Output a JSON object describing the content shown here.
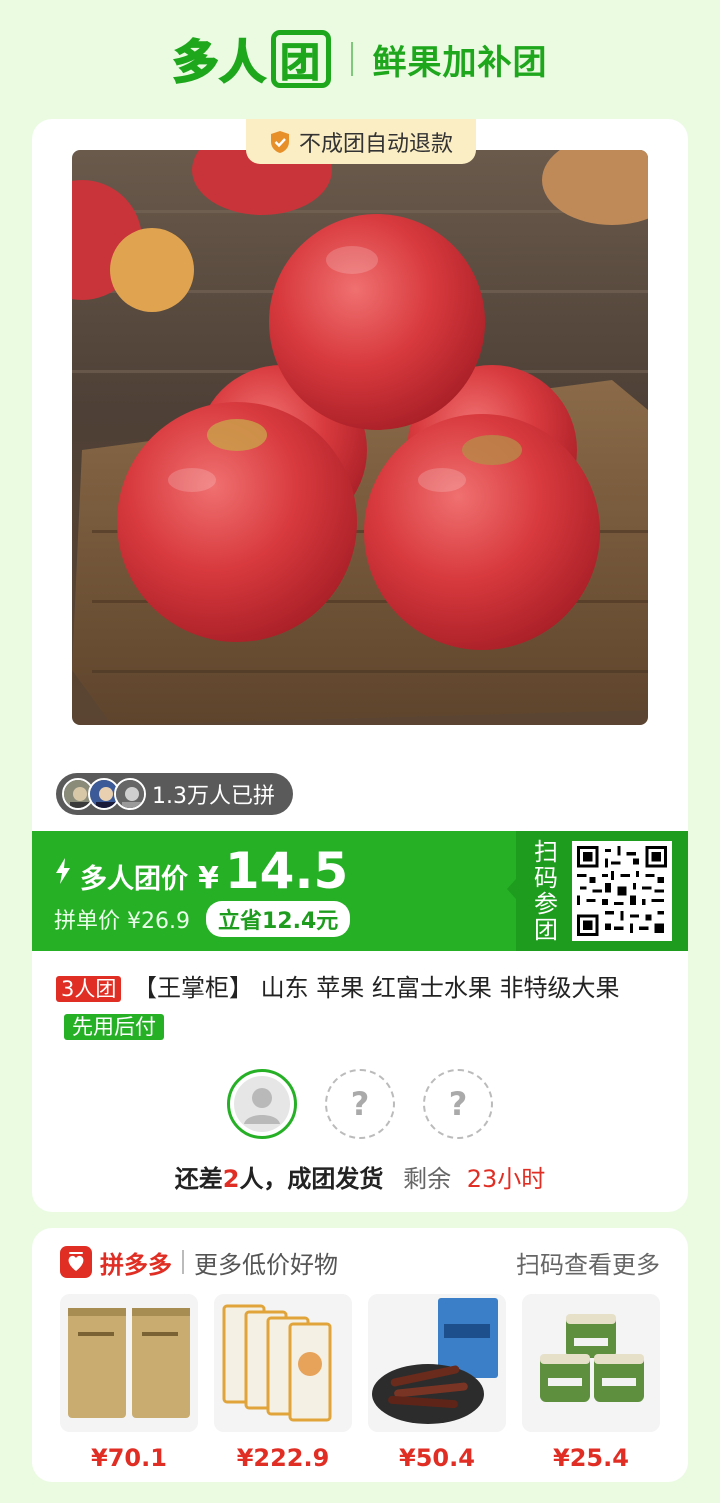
{
  "header": {
    "logo_part1": "多人",
    "logo_part2": "团",
    "subtitle": "鲜果加补团"
  },
  "product": {
    "badge": "不成团自动退款",
    "image_icon": "apples-photo",
    "joined_text": "1.3万人已拼"
  },
  "price": {
    "label": "多人团价",
    "currency": "¥",
    "group_price": "14.5",
    "original": "拼单价 ¥26.9",
    "saving": "立省12.4元",
    "scan_label": "扫码参团"
  },
  "title": {
    "group_tag": "3人团",
    "text": "【王掌柜】 山东 苹果 红富士水果 非特级大果",
    "pay_tag": "先用后付"
  },
  "group_status": {
    "prefix": "还差",
    "missing": "2",
    "suffix": "人，成团发货",
    "remain_label": "剩余",
    "remain_time": "23小时",
    "placeholder": "?"
  },
  "more": {
    "brand": "拼多多",
    "slogan": "更多低价好物",
    "link": "扫码查看更多",
    "items": [
      {
        "price": "¥70.1",
        "icon": "tea-bags"
      },
      {
        "price": "¥222.9",
        "icon": "cat-food-bags"
      },
      {
        "price": "¥50.4",
        "icon": "beef-jerky"
      },
      {
        "price": "¥25.4",
        "icon": "green-jars"
      }
    ]
  },
  "colors": {
    "brand_green": "#26b026",
    "deep_green": "#1e9c1e",
    "pdd_red": "#e02e24",
    "page_bg": "#eafbe2"
  }
}
